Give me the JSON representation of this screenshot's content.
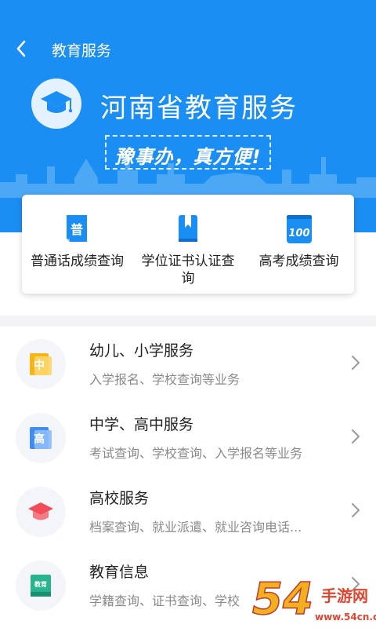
{
  "header": {
    "title": "教育服务",
    "back_icon": "chevron-left-icon"
  },
  "hero": {
    "title": "河南省教育服务",
    "slogan": "豫事办，真方便!",
    "logo_icon": "graduation-cap-icon"
  },
  "quick_links": [
    {
      "label_lines": [
        "普通话成绩查询"
      ],
      "icon": "putonghua-doc-icon",
      "glyph": "普",
      "color": "#1a8ef3"
    },
    {
      "label_lines": [
        "学位证书认证查",
        "询"
      ],
      "icon": "bookmark-book-icon",
      "color": "#1a8ef3"
    },
    {
      "label_lines": [
        "高考成绩查询"
      ],
      "icon": "score-100-icon",
      "glyph": "100",
      "color": "#1a8ef3"
    }
  ],
  "services": [
    {
      "title": "幼儿、小学服务",
      "subtitle": "入学报名、学校查询等业务",
      "icon": "primary-school-icon",
      "glyph": "中",
      "color": "#f5b518"
    },
    {
      "title": "中学、高中服务",
      "subtitle": "考试查询、学校查询、入学报名等业务",
      "icon": "high-school-icon",
      "glyph": "高",
      "color": "#3f8ef0"
    },
    {
      "title": "高校服务",
      "subtitle": "档案查询、就业派遣、就业咨询电话...",
      "icon": "university-cap-icon",
      "color": "#f04d5a"
    },
    {
      "title": "教育信息",
      "subtitle": "学籍查询、证书查询、学校",
      "icon": "education-book-icon",
      "glyph": "教育",
      "color": "#27b48e"
    }
  ],
  "watermark": {
    "logo_text": "54",
    "site_name": "手游网",
    "url": "www.54cn.cn"
  },
  "colors": {
    "brand_blue": "#1a8ef3",
    "text_primary": "#222222",
    "text_secondary": "#8a8a8a"
  }
}
